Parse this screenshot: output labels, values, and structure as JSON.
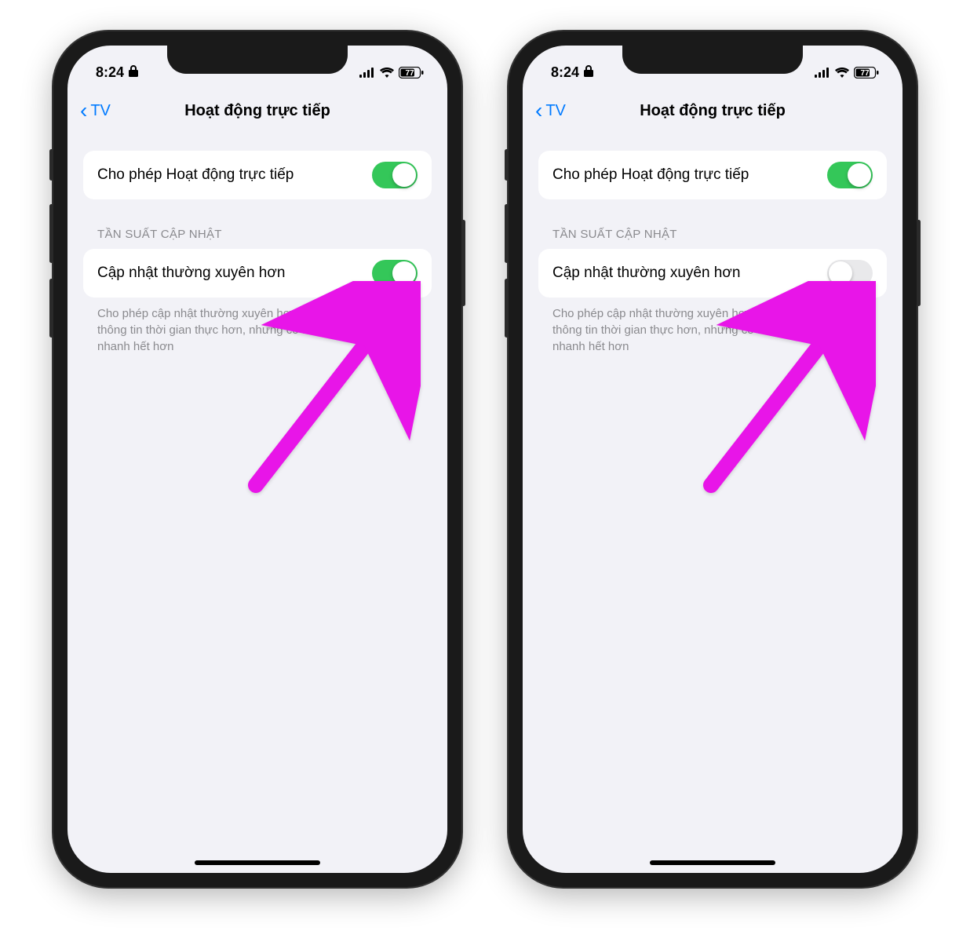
{
  "phones": [
    {
      "status": {
        "time": "8:24",
        "lockIcon": "lock-icon",
        "battery": "77"
      },
      "nav": {
        "back": "TV",
        "title": "Hoạt động trực tiếp"
      },
      "allowRow": {
        "label": "Cho phép Hoạt động trực tiếp",
        "on": true
      },
      "sectionHeader": "TẦN SUẤT CẬP NHẬT",
      "freqRow": {
        "label": "Cập nhật thường xuyên hơn",
        "on": true
      },
      "footer": "Cho phép cập nhật thường xuyên hơn để có thể xem nhiều thông tin thời gian thực hơn, nhưng có thể làm cho pin nhanh hết hơn"
    },
    {
      "status": {
        "time": "8:24",
        "lockIcon": "lock-icon",
        "battery": "77"
      },
      "nav": {
        "back": "TV",
        "title": "Hoạt động trực tiếp"
      },
      "allowRow": {
        "label": "Cho phép Hoạt động trực tiếp",
        "on": true
      },
      "sectionHeader": "TẦN SUẤT CẬP NHẬT",
      "freqRow": {
        "label": "Cập nhật thường xuyên hơn",
        "on": false
      },
      "footer": "Cho phép cập nhật thường xuyên hơn để có thể xem nhiều thông tin thời gian thực hơn, nhưng có thể làm cho pin nhanh hết hơn"
    }
  ],
  "colors": {
    "accent": "#007aff",
    "toggleOn": "#34c759",
    "arrow": "#e815e8"
  }
}
